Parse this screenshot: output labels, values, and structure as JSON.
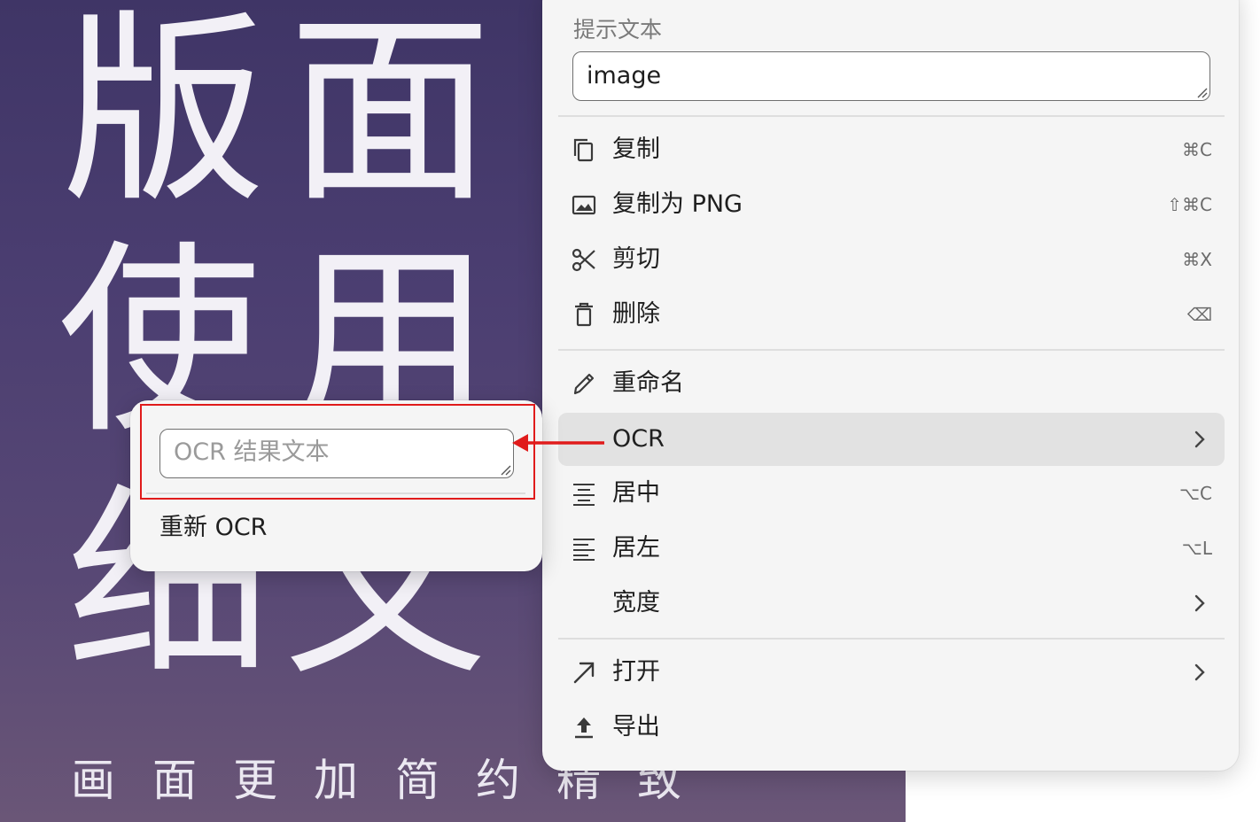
{
  "background_image": {
    "glyph_rows": [
      [
        "版",
        "面"
      ],
      [
        "使",
        "用"
      ],
      [
        "细",
        "文"
      ]
    ],
    "caption": [
      "画",
      "面",
      "更",
      "加",
      "简",
      "约",
      "精",
      "致"
    ]
  },
  "menu": {
    "alt_text_label": "提示文本",
    "alt_text_value": "image",
    "items": [
      {
        "label": "复制",
        "shortcut": "⌘C",
        "icon": "copy-icon"
      },
      {
        "label": "复制为 PNG",
        "shortcut": "⇧⌘C",
        "icon": "image-icon"
      },
      {
        "label": "剪切",
        "shortcut": "⌘X",
        "icon": "scissors-icon"
      },
      {
        "label": "删除",
        "shortcut": "⌫",
        "icon": "trash-icon"
      },
      {
        "label": "重命名",
        "shortcut": "",
        "icon": "pencil-icon"
      },
      {
        "label": "OCR",
        "shortcut": "",
        "icon": "",
        "has_submenu": true,
        "active": true
      },
      {
        "label": "居中",
        "shortcut": "⌥C",
        "icon": "align-center-icon"
      },
      {
        "label": "居左",
        "shortcut": "⌥L",
        "icon": "align-left-icon"
      },
      {
        "label": "宽度",
        "shortcut": "",
        "icon": "",
        "has_submenu": true
      },
      {
        "label": "打开",
        "shortcut": "",
        "icon": "arrow-up-right-icon",
        "has_submenu": true
      },
      {
        "label": "导出",
        "shortcut": "",
        "icon": "upload-icon"
      }
    ]
  },
  "submenu": {
    "ocr_placeholder": "OCR 结果文本",
    "rerun_label": "重新 OCR"
  },
  "colors": {
    "menu_bg": "#f5f5f5",
    "active_item_bg": "#e2e2e2",
    "annotation_red": "#e01b1b",
    "image_bg": "#4b3e71"
  }
}
